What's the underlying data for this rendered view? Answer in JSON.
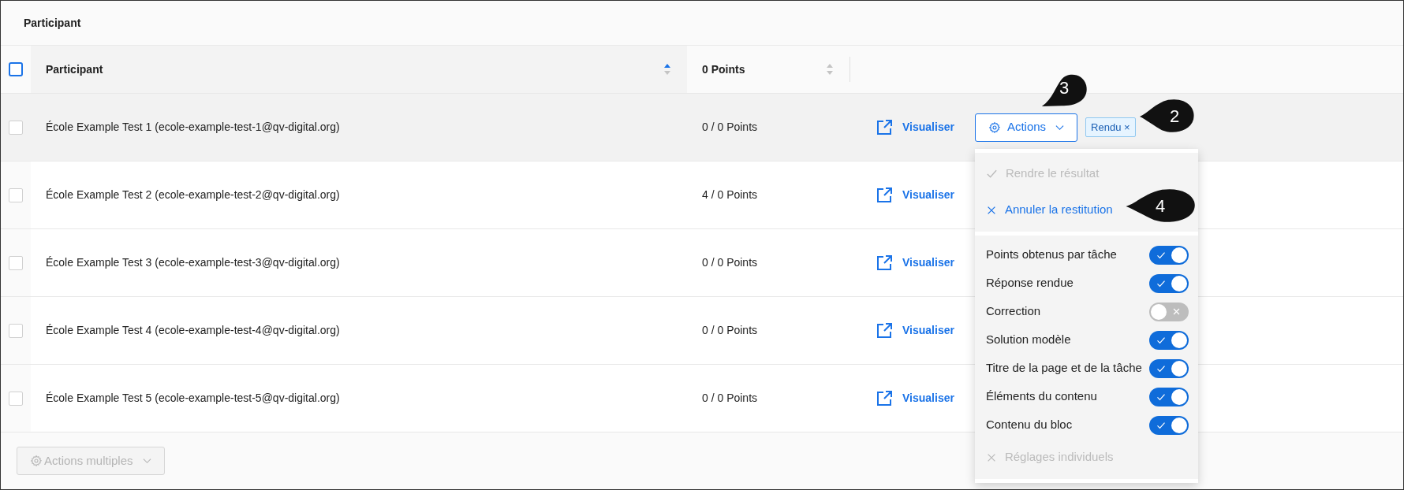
{
  "title": "Participant",
  "table": {
    "header_checkbox": {
      "checked": false
    },
    "columns": [
      {
        "label": "Participant",
        "sorted": true
      },
      {
        "label": "0 Points",
        "sorted": false
      }
    ],
    "rows": [
      {
        "participant": "École Example Test 1 (ecole-example-test-1@qv-digital.org)",
        "points": "0 / 0 Points",
        "action": "Visualiser",
        "checked": false,
        "highlighted": true,
        "actions_button": "Actions",
        "tag": "Rendu ×"
      },
      {
        "participant": "École Example Test 2 (ecole-example-test-2@qv-digital.org)",
        "points": "4 / 0 Points",
        "action": "Visualiser",
        "checked": false,
        "highlighted": false
      },
      {
        "participant": "École Example Test 3 (ecole-example-test-3@qv-digital.org)",
        "points": "0 / 0 Points",
        "action": "Visualiser",
        "checked": false,
        "highlighted": false
      },
      {
        "participant": "École Example Test 4 (ecole-example-test-4@qv-digital.org)",
        "points": "0 / 0 Points",
        "action": "Visualiser",
        "checked": false,
        "highlighted": false
      },
      {
        "participant": "École Example Test 5 (ecole-example-test-5@qv-digital.org)",
        "points": "0 / 0 Points",
        "action": "Visualiser",
        "checked": false,
        "highlighted": false
      }
    ]
  },
  "dropdown": {
    "items": [
      {
        "kind": "confirm",
        "label": "Rendre le résultat",
        "disabled": true
      },
      {
        "kind": "cancel",
        "label": "Annuler la restitution",
        "disabled": false
      },
      {
        "kind": "divider"
      },
      {
        "kind": "toggle",
        "label": "Points obtenus par tâche",
        "on": true
      },
      {
        "kind": "toggle",
        "label": "Réponse rendue",
        "on": true
      },
      {
        "kind": "toggle",
        "label": "Correction",
        "on": false
      },
      {
        "kind": "toggle",
        "label": "Solution modèle",
        "on": true
      },
      {
        "kind": "toggle",
        "label": "Titre de la page et de la tâche",
        "on": true
      },
      {
        "kind": "toggle",
        "label": "Éléments du contenu",
        "on": true
      },
      {
        "kind": "toggle",
        "label": "Contenu du bloc",
        "on": true
      },
      {
        "kind": "cancel",
        "label": "Réglages individuels",
        "disabled": true
      }
    ]
  },
  "footer": {
    "button": "Actions multiples",
    "disabled": true
  },
  "callouts": [
    {
      "label": "3",
      "kind": "down"
    },
    {
      "label": "2",
      "kind": "left"
    },
    {
      "label": "4",
      "kind": "left"
    }
  ]
}
